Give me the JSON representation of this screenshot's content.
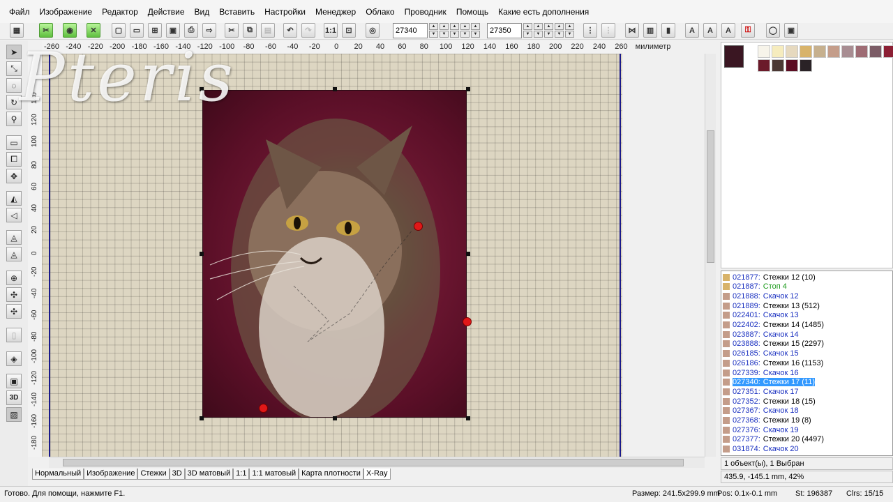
{
  "menu": [
    "Файл",
    "Изображение",
    "Редактор",
    "Действие",
    "Вид",
    "Вставить",
    "Настройки",
    "Менеджер",
    "Облако",
    "Проводник",
    "Помощь",
    "Какие есть дополнения"
  ],
  "toolbar": {
    "field1": "27340",
    "field2": "27350"
  },
  "ruler": {
    "unit_label": "милиметр",
    "h_ticks": [
      "-260",
      "-240",
      "-220",
      "-200",
      "-180",
      "-160",
      "-140",
      "-120",
      "-100",
      "-80",
      "-60",
      "-40",
      "-20",
      "0",
      "20",
      "40",
      "60",
      "80",
      "100",
      "120",
      "140",
      "160",
      "180",
      "200",
      "220",
      "240",
      "260"
    ],
    "v_ticks": [
      "140",
      "120",
      "100",
      "80",
      "60",
      "40",
      "20",
      "0",
      "-20",
      "-40",
      "-60",
      "-80",
      "-100",
      "-120",
      "-140",
      "-160",
      "-180"
    ]
  },
  "watermark": "Pteris",
  "tabs": [
    "Нормальный",
    "Изображение",
    "Стежки",
    "3D",
    "3D матовый",
    "1:1",
    "1:1 матовый",
    "Карта плотности",
    "X-Ray"
  ],
  "palette": {
    "colors": [
      "#f7f4ea",
      "#f6ecbe",
      "#e6d9bf",
      "#d8b36a",
      "#c6b08e",
      "#c49d8a",
      "#a88d92",
      "#9e6c74",
      "#7b5c66",
      "#8c1f34",
      "#6b1a2a",
      "#4b3833",
      "#5c0d23",
      "#2a2226"
    ]
  },
  "stitch_list": [
    {
      "id": "021877:",
      "label": "Стежки 12 (10)",
      "type": "stitch",
      "color": "#d8b36a"
    },
    {
      "id": "021887:",
      "label": "Стоп 4",
      "type": "stop",
      "color": "#d8b36a"
    },
    {
      "id": "021888:",
      "label": "Скачок 12",
      "type": "jump",
      "color": "#c49d8a"
    },
    {
      "id": "021889:",
      "label": "Стежки 13 (512)",
      "type": "stitch",
      "color": "#c49d8a"
    },
    {
      "id": "022401:",
      "label": "Скачок 13",
      "type": "jump",
      "color": "#c49d8a"
    },
    {
      "id": "022402:",
      "label": "Стежки 14 (1485)",
      "type": "stitch",
      "color": "#c49d8a"
    },
    {
      "id": "023887:",
      "label": "Скачок 14",
      "type": "jump",
      "color": "#c49d8a"
    },
    {
      "id": "023888:",
      "label": "Стежки 15 (2297)",
      "type": "stitch",
      "color": "#c49d8a"
    },
    {
      "id": "026185:",
      "label": "Скачок 15",
      "type": "jump",
      "color": "#c49d8a"
    },
    {
      "id": "026186:",
      "label": "Стежки 16 (1153)",
      "type": "stitch",
      "color": "#c49d8a"
    },
    {
      "id": "027339:",
      "label": "Скачок 16",
      "type": "jump",
      "color": "#c49d8a"
    },
    {
      "id": "027340:",
      "label": "Стежки 17 (11)",
      "type": "selected",
      "color": "#c49d8a"
    },
    {
      "id": "027351:",
      "label": "Скачок 17",
      "type": "jump",
      "color": "#c49d8a"
    },
    {
      "id": "027352:",
      "label": "Стежки 18 (15)",
      "type": "stitch",
      "color": "#c49d8a"
    },
    {
      "id": "027367:",
      "label": "Скачок 18",
      "type": "jump",
      "color": "#c49d8a"
    },
    {
      "id": "027368:",
      "label": "Стежки 19 (8)",
      "type": "stitch",
      "color": "#c49d8a"
    },
    {
      "id": "027376:",
      "label": "Скачок 19",
      "type": "jump",
      "color": "#c49d8a"
    },
    {
      "id": "027377:",
      "label": "Стежки 20 (4497)",
      "type": "stitch",
      "color": "#c49d8a"
    },
    {
      "id": "031874:",
      "label": "Скачок 20",
      "type": "jump",
      "color": "#c49d8a"
    }
  ],
  "info": {
    "objects": "1 объект(ы), 1 Выбран",
    "coords": "435.9, -145.1 mm, 42%"
  },
  "status": {
    "ready": "Готово. Для помощи, нажмите F1.",
    "size": "Размер: 241.5x299.9 mm",
    "pos": "Pos: 0.1x-0.1 mm",
    "st": "St: 196387",
    "clrs": "Clrs: 15/15"
  }
}
